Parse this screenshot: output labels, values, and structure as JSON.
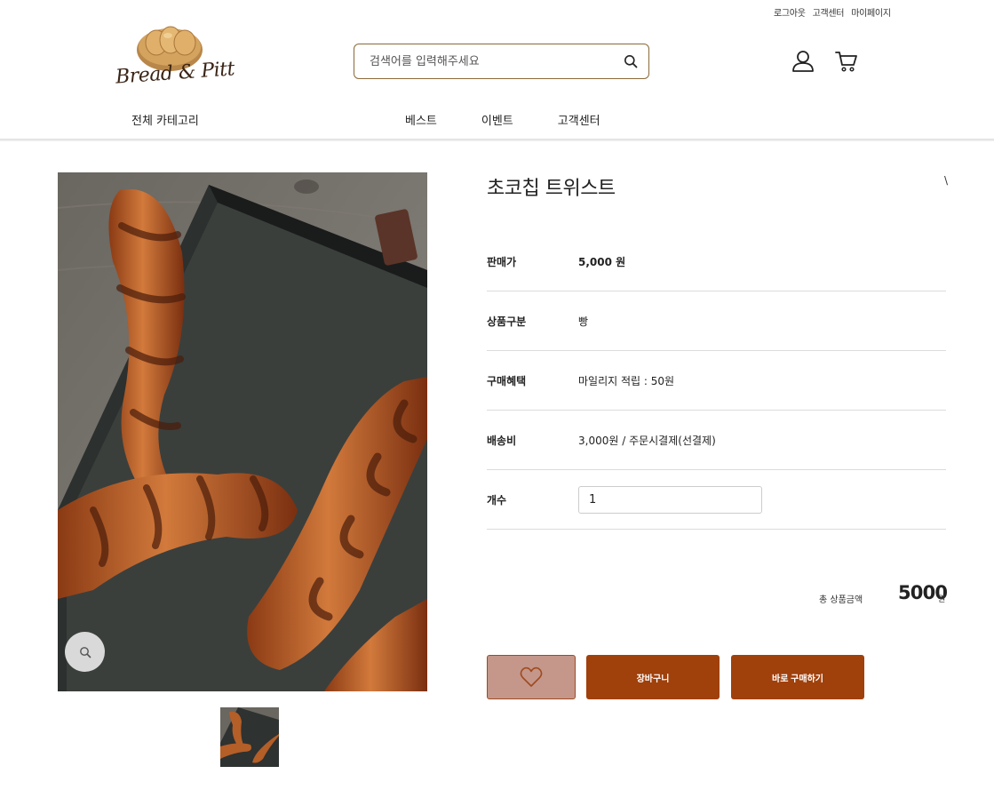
{
  "util_links": [
    "로그아웃",
    "고객센터",
    "마이페이지"
  ],
  "logo": {
    "text": "Bread & Pitt"
  },
  "search": {
    "placeholder": "검색어를 입력해주세요"
  },
  "nav": {
    "all_categories": "전체 카테고리",
    "items": [
      "베스트",
      "이벤트",
      "고객센터"
    ]
  },
  "product": {
    "title": "초코칩 트위스트",
    "share_mark": "\\"
  },
  "info": [
    {
      "label": "판매가",
      "value": "5,000 원"
    },
    {
      "label": "상품구분",
      "value": "빵"
    },
    {
      "label": "구매혜택",
      "value": "마일리지 적립 : 50원"
    },
    {
      "label": "배송비",
      "value": "3,000원 / 주문시결제(선결제)"
    },
    {
      "label": "개수",
      "value": "1"
    }
  ],
  "total": {
    "label": "총 상품금액",
    "amount": "5000",
    "unit": "원"
  },
  "buttons": {
    "cart": "장바구니",
    "buy": "바로 구매하기"
  },
  "colors": {
    "accent": "#a0400b",
    "wish_bg": "#c4978a",
    "search_border": "#8a6a3a"
  }
}
